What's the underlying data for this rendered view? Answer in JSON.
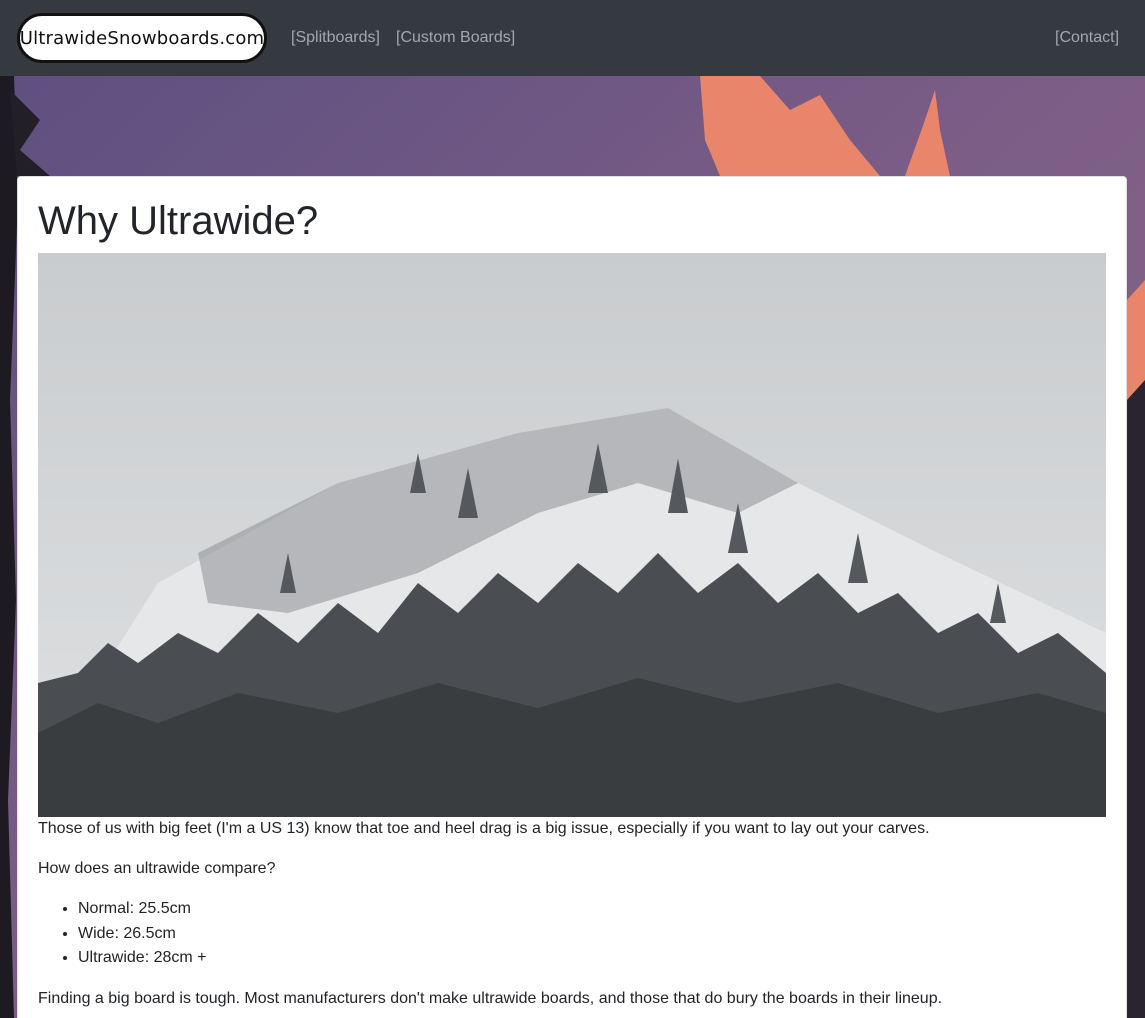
{
  "nav": {
    "brand": "UltrawideSnowboards.com",
    "splitboards": "[Splitboards]",
    "custom_boards": "[Custom Boards]",
    "contact": "[Contact]"
  },
  "article": {
    "title": "Why Ultrawide?",
    "intro": "Those of us with big feet (I'm a US 13) know that toe and heel drag is a big issue, especially if you want to lay out your carves.",
    "compare_question": "How does an ultrawide compare?",
    "specs": [
      "Normal: 25.5cm",
      "Wide: 26.5cm",
      "Ultrawide: 28cm +"
    ],
    "closing": "Finding a big board is tough. Most manufacturers don't make ultrawide boards, and those that do bury the boards in their lineup."
  },
  "colors": {
    "navbar": "#343a40",
    "nav_link": "rgba(255,255,255,0.55)",
    "text": "#212529",
    "sky_orange": "#e8856a"
  }
}
